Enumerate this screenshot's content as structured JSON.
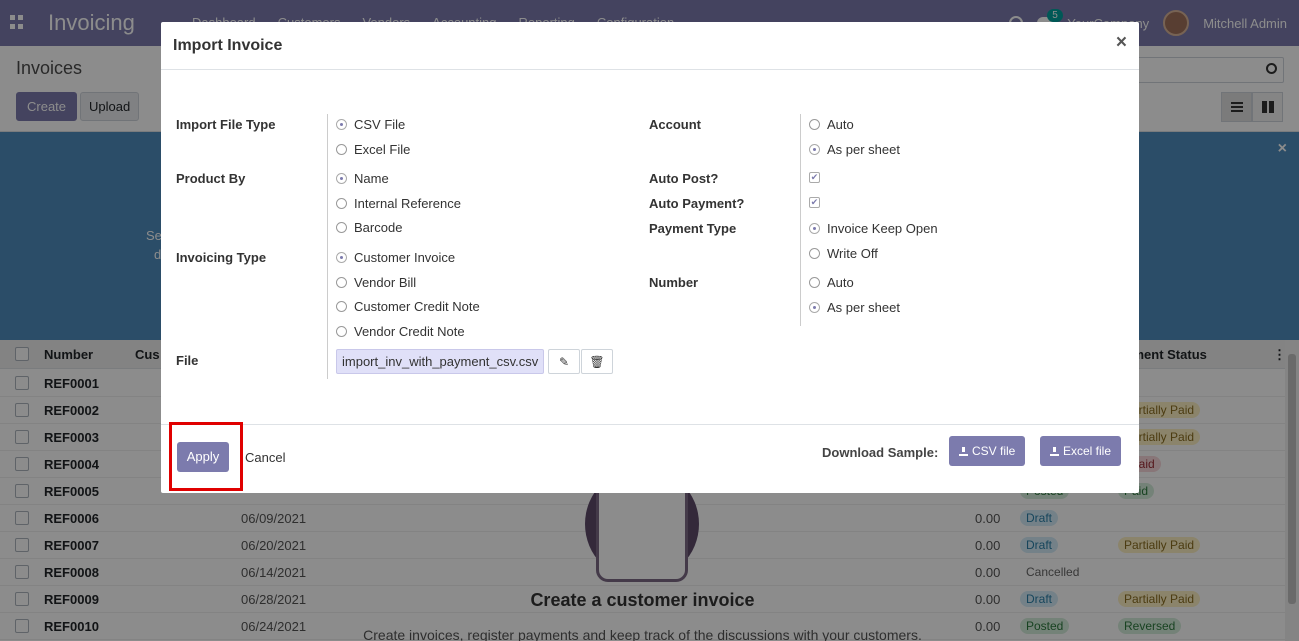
{
  "navbar": {
    "app_title": "Invoicing",
    "menu": [
      "Dashboard",
      "Customers",
      "Vendors",
      "Accounting",
      "Reporting",
      "Configuration"
    ],
    "chat_count": "5",
    "company": "YourCompany",
    "user": "Mitchell Admin"
  },
  "control_panel": {
    "title": "Invoices",
    "create_label": "Create",
    "upload_label": "Upload"
  },
  "banner": {
    "line1": "Se",
    "line2": "d"
  },
  "list": {
    "headers": {
      "number": "Number",
      "customer": "Cus",
      "payment_status": "ayment Status"
    },
    "rows": [
      {
        "ref": "REF0001",
        "date": "",
        "amount": "",
        "status": "",
        "status_kind": "",
        "payment": "",
        "payment_kind": ""
      },
      {
        "ref": "REF0002",
        "date": "",
        "amount": "",
        "status": "",
        "status_kind": "",
        "payment": "Partially Paid",
        "payment_kind": "partial"
      },
      {
        "ref": "REF0003",
        "date": "",
        "amount": "",
        "status": "",
        "status_kind": "",
        "payment": "Partially Paid",
        "payment_kind": "partial"
      },
      {
        "ref": "REF0004",
        "date": "",
        "amount": "",
        "status": "",
        "status_kind": "",
        "payment": "t Paid",
        "payment_kind": "notpaid"
      },
      {
        "ref": "REF0005",
        "date": "",
        "amount": "",
        "status": "Posted",
        "status_kind": "posted",
        "payment": "Paid",
        "payment_kind": "paid"
      },
      {
        "ref": "REF0006",
        "date": "06/09/2021",
        "amount": "0.00",
        "status": "Draft",
        "status_kind": "draft",
        "payment": "",
        "payment_kind": ""
      },
      {
        "ref": "REF0007",
        "date": "06/20/2021",
        "amount": "0.00",
        "status": "Draft",
        "status_kind": "draft",
        "payment": "Partially Paid",
        "payment_kind": "partial"
      },
      {
        "ref": "REF0008",
        "date": "06/14/2021",
        "amount": "0.00",
        "status": "Cancelled",
        "status_kind": "cancel",
        "payment": "",
        "payment_kind": ""
      },
      {
        "ref": "REF0009",
        "date": "06/28/2021",
        "amount": "0.00",
        "status": "Draft",
        "status_kind": "draft",
        "payment": "Partially Paid",
        "payment_kind": "partial"
      },
      {
        "ref": "REF0010",
        "date": "06/24/2021",
        "amount": "0.00",
        "status": "Posted",
        "status_kind": "posted",
        "payment": "Reversed",
        "payment_kind": "rev"
      }
    ]
  },
  "helper": {
    "title": "Create a customer invoice",
    "text": "Create invoices, register payments and keep track of the discussions with your customers."
  },
  "modal": {
    "title": "Import Invoice",
    "close_symbol": "×",
    "import_file_type": {
      "label": "Import File Type",
      "options": [
        {
          "label": "CSV File",
          "selected": true
        },
        {
          "label": "Excel File",
          "selected": false
        }
      ]
    },
    "product_by": {
      "label": "Product By",
      "options": [
        {
          "label": "Name",
          "selected": true
        },
        {
          "label": "Internal Reference",
          "selected": false
        },
        {
          "label": "Barcode",
          "selected": false
        }
      ]
    },
    "invoicing_type": {
      "label": "Invoicing Type",
      "options": [
        {
          "label": "Customer Invoice",
          "selected": true
        },
        {
          "label": "Vendor Bill",
          "selected": false
        },
        {
          "label": "Customer Credit Note",
          "selected": false
        },
        {
          "label": "Vendor Credit Note",
          "selected": false
        }
      ]
    },
    "file": {
      "label": "File",
      "filename": "import_inv_with_payment_csv.csv"
    },
    "account": {
      "label": "Account",
      "options": [
        {
          "label": "Auto",
          "selected": false
        },
        {
          "label": "As per sheet",
          "selected": true
        }
      ]
    },
    "auto_post": {
      "label": "Auto Post?",
      "checked": true
    },
    "auto_payment": {
      "label": "Auto Payment?",
      "checked": true
    },
    "payment_type": {
      "label": "Payment Type",
      "options": [
        {
          "label": "Invoice Keep Open",
          "selected": true
        },
        {
          "label": "Write Off",
          "selected": false
        }
      ]
    },
    "number": {
      "label": "Number",
      "options": [
        {
          "label": "Auto",
          "selected": false
        },
        {
          "label": "As per sheet",
          "selected": true
        }
      ]
    },
    "footer": {
      "apply_label": "Apply",
      "cancel_label": "Cancel",
      "download_label": "Download Sample:",
      "csv_label": "CSV file",
      "excel_label": "Excel file"
    }
  },
  "colors": {
    "brand": "#7c7bad",
    "banner": "#4f8dbd",
    "highlight": "#e00000"
  }
}
